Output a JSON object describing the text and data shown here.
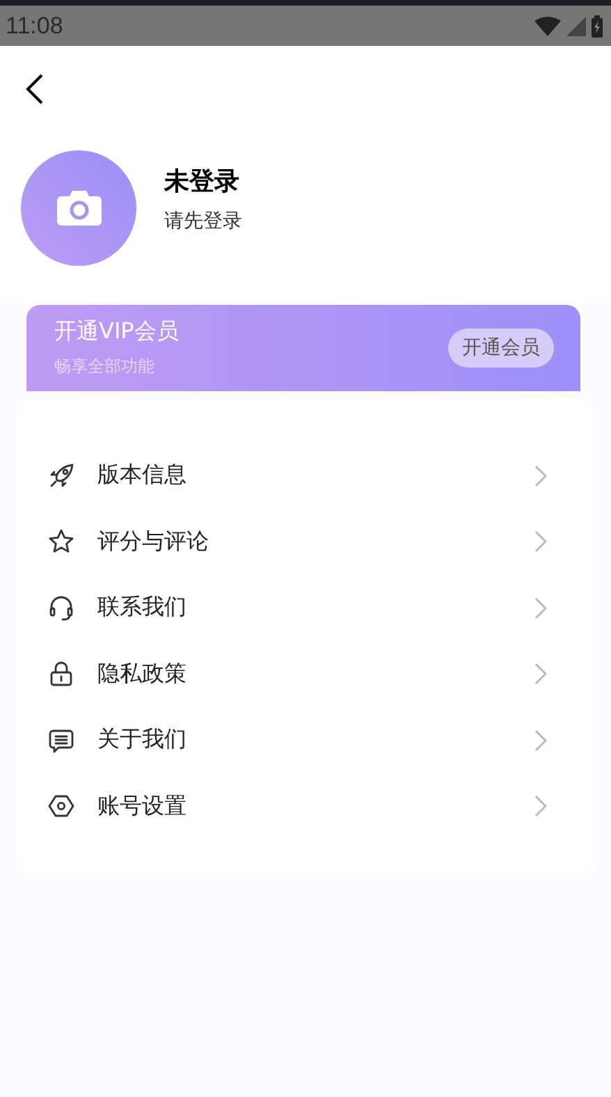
{
  "status_bar": {
    "time": "11:08"
  },
  "profile": {
    "name": "未登录",
    "hint": "请先登录"
  },
  "vip": {
    "title": "开通VIP会员",
    "subtitle": "畅享全部功能",
    "button": "开通会员"
  },
  "menu": [
    {
      "label": "版本信息"
    },
    {
      "label": "评分与评论"
    },
    {
      "label": "联系我们"
    },
    {
      "label": "隐私政策"
    },
    {
      "label": "关于我们"
    },
    {
      "label": "账号设置"
    }
  ]
}
